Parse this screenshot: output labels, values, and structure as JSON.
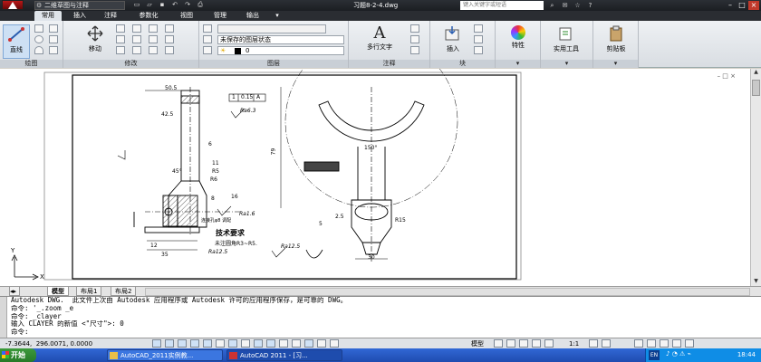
{
  "titlebar": {
    "workspace": "二维草图与注释",
    "document_title": "习题8-2-4.dwg",
    "search_placeholder": "键入关键字或短语"
  },
  "ribbon_tabs": [
    "常用",
    "插入",
    "注释",
    "参数化",
    "视图",
    "管理",
    "输出"
  ],
  "ribbon": {
    "draw_panel": {
      "big_button": "直线",
      "label": "绘图"
    },
    "modify_panel": {
      "big_button": "移动",
      "label": "修改"
    },
    "layers_panel": {
      "layer_state": "未保存的图层状态",
      "current_layer": "0",
      "label": "图层"
    },
    "annotation_panel": {
      "big_button": "多行文字",
      "label": "注释"
    },
    "block_panel": {
      "big_button": "插入",
      "label": "块"
    },
    "properties_button": "特性",
    "utilities_button": "实用工具",
    "clipboard_button": "剪贴板"
  },
  "drawing": {
    "tech_req_title": "技术要求",
    "tech_req_body": "未注圆角R3~R5.",
    "roughness": [
      "Ra6.3",
      "Ra12.5",
      "Ra1.6",
      "Ra12.5"
    ],
    "dims": [
      "50.5",
      "1",
      "0.15",
      "A",
      "6",
      "42.5",
      "79",
      "8",
      "16",
      "11",
      "45°",
      "R5",
      "R6",
      "R15",
      "30",
      "150°",
      "2.5",
      "35",
      "12",
      "5"
    ],
    "notes": [
      "连接孔φ8 调配"
    ],
    "ucs_y": "Y",
    "ucs_x": "X"
  },
  "layout_tabs": [
    "模型",
    "布局1",
    "布局2"
  ],
  "command_lines": [
    "Autodesk DWG.  此文件上次由 Autodesk 应用程序或 Autodesk 许可的应用程序保存，是可靠的 DWG。",
    "命令: '_.zoom _e",
    "命令: _clayer",
    "输入 CLAYER 的新值 <\"尺寸\">: 0",
    "命令:"
  ],
  "statusbar": {
    "coordinates": "-7.3644,  296.0071, 0.0000",
    "model_label": "模型",
    "scale": "1:1"
  },
  "taskbar": {
    "start": "开始",
    "tasks": [
      "AutoCAD_2011实例教...",
      "AutoCAD 2011 - [习..."
    ],
    "language": "EN",
    "clock": "18:44"
  },
  "colors": {
    "accent": "#1f4bb0",
    "titlebar": "#2b2f35"
  }
}
